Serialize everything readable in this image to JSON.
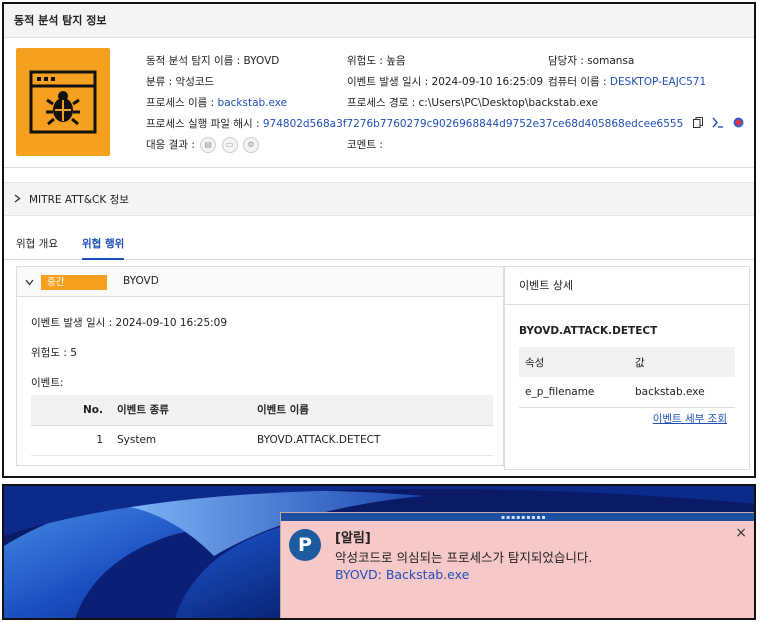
{
  "panel": {
    "title": "동적 분석 탐지 정보",
    "info": {
      "detection_name_key": "동적 분석 탐지 이름 :",
      "detection_name_val": "BYOVD",
      "category_key": "분류 :",
      "category_val": "악성코드",
      "process_name_key": "프로세스 이름 :",
      "process_name_val": "backstab.exe",
      "hash_key": "프로세스 실행 파일 해시 :",
      "hash_val": "974802d568a3f7276b7760279c9026968844d9752e37ce68d405868edcee6555",
      "response_key": "대응 결과 :",
      "risk_key": "위험도 :",
      "risk_val": "높음",
      "event_time_key": "이벤트 발생 일시 :",
      "event_time_val": "2024-09-10 16:25:09",
      "process_path_key": "프로세스 경로 :",
      "process_path_val": "c:\\Users\\PC\\Desktop\\backstab.exe",
      "comment_key": "코멘트 :",
      "owner_key": "담당자 :",
      "owner_val": "somansa",
      "computer_key": "컴퓨터 이름 :",
      "computer_val": "DESKTOP-EAJC571"
    },
    "mitre_label": "MITRE ATT&CK 정보",
    "tabs": [
      "위협 개요",
      "위협 행위"
    ],
    "left_card": {
      "severity": "중간",
      "name": "BYOVD",
      "event_time": "이벤트 발생 일시 : 2024-09-10 16:25:09",
      "risk": "위험도 : 5",
      "events_label": "이벤트:",
      "columns": [
        "No.",
        "이벤트 종류",
        "이벤트 이름"
      ],
      "rows": [
        [
          "1",
          "System",
          "BYOVD.ATTACK.DETECT"
        ]
      ]
    },
    "right_card": {
      "title": "이벤트 상세",
      "subtitle": "BYOVD.ATTACK.DETECT",
      "columns": [
        "속성",
        "값"
      ],
      "rows": [
        [
          "e_p_filename",
          "backstab.exe"
        ]
      ],
      "link": "이벤트 세부 조회"
    }
  },
  "toast": {
    "title": "[알림]",
    "message": "악성코드로 의심되는 프로세스가 탐지되었습니다.",
    "source": "BYOVD: Backstab.exe",
    "logo_letter": "P",
    "close": "×"
  },
  "icons": [
    "bug-icon",
    "copy-icon",
    "terminal-icon",
    "virustotal-icon",
    "google-icon",
    "document-icon",
    "monitor-icon",
    "gear-icon",
    "chevron-right-icon",
    "chevron-down-icon",
    "close-icon"
  ],
  "colors": {
    "accent": "#f5a11f",
    "link": "#1f4fb8",
    "toast_bg": "#f7c8c8",
    "toast_bar": "#1d4fa3"
  }
}
